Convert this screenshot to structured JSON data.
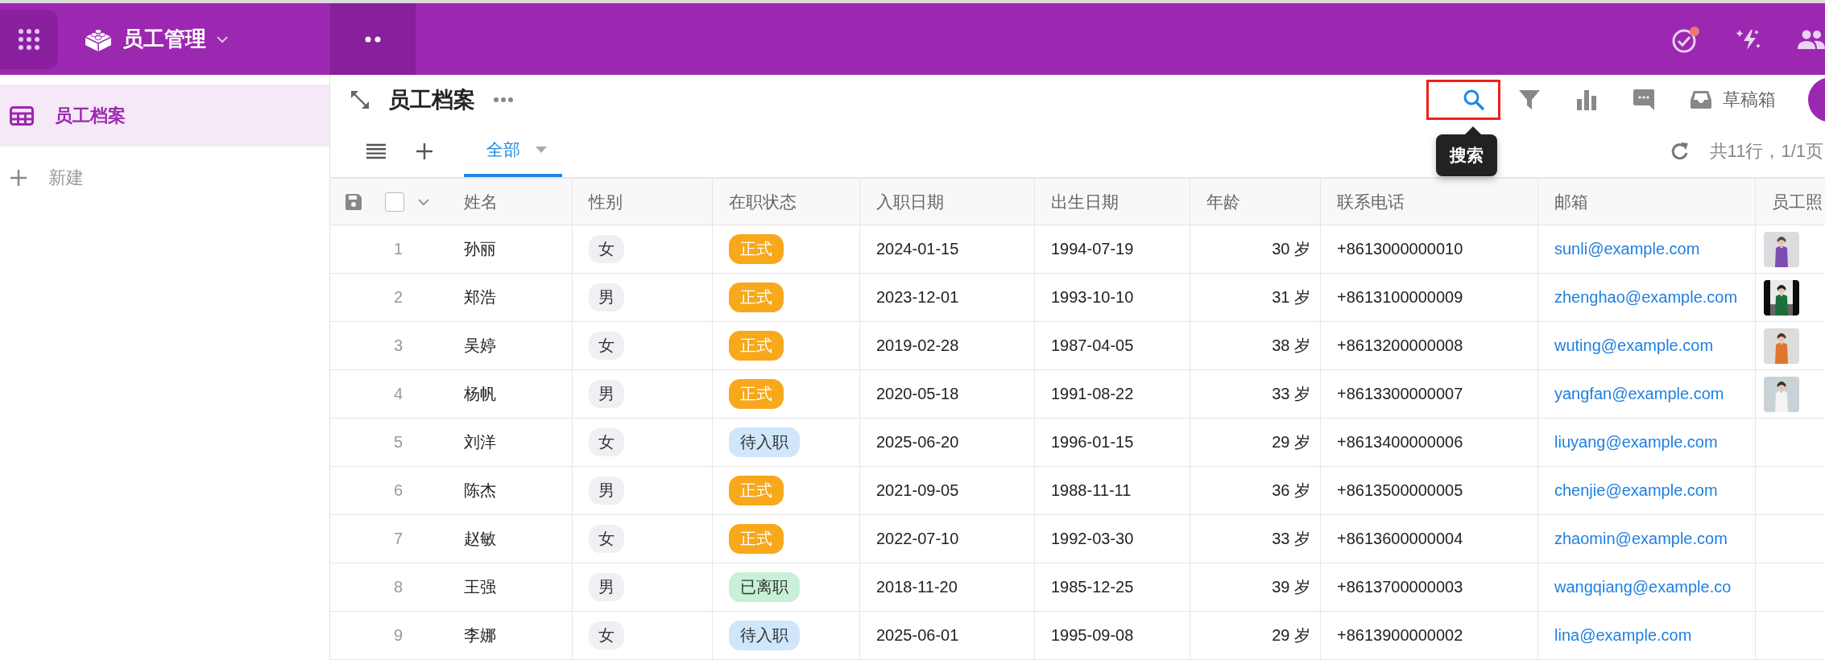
{
  "app": {
    "title": "员工管理"
  },
  "sidebar": {
    "items": [
      {
        "kind": "table",
        "label": "员工档案",
        "selected": true
      },
      {
        "kind": "add",
        "label": "新建",
        "selected": false
      }
    ]
  },
  "view": {
    "title": "员工档案",
    "tools": [
      {
        "kind": "search",
        "highlighted": true,
        "tooltip": "搜索"
      },
      {
        "kind": "filter",
        "highlighted": false
      },
      {
        "kind": "chart",
        "highlighted": false
      },
      {
        "kind": "comment",
        "highlighted": false
      },
      {
        "kind": "drafts",
        "highlighted": false,
        "label": "草稿箱"
      }
    ],
    "tabs": [
      {
        "label": "全部",
        "selected": true
      }
    ],
    "summary": "共11行，1/1页"
  },
  "table": {
    "select_all": {
      "checked": false
    },
    "columns": [
      "姓名",
      "性别",
      "在职状态",
      "入职日期",
      "出生日期",
      "年龄",
      "联系电话",
      "邮箱",
      "员工照"
    ],
    "rows": [
      {
        "index": "1",
        "name": "孙丽",
        "gender": "女",
        "status": {
          "label": "正式",
          "color": "#f7a81b"
        },
        "hire_date": "2024-01-15",
        "birth_date": "1994-07-19",
        "age": "30 岁",
        "phone": "+8613000000010",
        "email": "sunli@example.com"
      },
      {
        "index": "2",
        "name": "郑浩",
        "gender": "男",
        "status": {
          "label": "正式",
          "color": "#f7a81b"
        },
        "hire_date": "2023-12-01",
        "birth_date": "1993-10-10",
        "age": "31 岁",
        "phone": "+8613100000009",
        "email": "zhenghao@example.com"
      },
      {
        "index": "3",
        "name": "吴婷",
        "gender": "女",
        "status": {
          "label": "正式",
          "color": "#f7a81b"
        },
        "hire_date": "2019-02-28",
        "birth_date": "1987-04-05",
        "age": "38 岁",
        "phone": "+8613200000008",
        "email": "wuting@example.com"
      },
      {
        "index": "4",
        "name": "杨帆",
        "gender": "男",
        "status": {
          "label": "正式",
          "color": "#f7a81b"
        },
        "hire_date": "2020-05-18",
        "birth_date": "1991-08-22",
        "age": "33 岁",
        "phone": "+8613300000007",
        "email": "yangfan@example.com"
      },
      {
        "index": "5",
        "name": "刘洋",
        "gender": "女",
        "status": {
          "label": "待入职",
          "color": "#cfe6fb"
        },
        "hire_date": "2025-06-20",
        "birth_date": "1996-01-15",
        "age": "29 岁",
        "phone": "+8613400000006",
        "email": "liuyang@example.com"
      },
      {
        "index": "6",
        "name": "陈杰",
        "gender": "男",
        "status": {
          "label": "正式",
          "color": "#f7a81b"
        },
        "hire_date": "2021-09-05",
        "birth_date": "1988-11-11",
        "age": "36 岁",
        "phone": "+8613500000005",
        "email": "chenjie@example.com"
      },
      {
        "index": "7",
        "name": "赵敏",
        "gender": "女",
        "status": {
          "label": "正式",
          "color": "#f7a81b"
        },
        "hire_date": "2022-07-10",
        "birth_date": "1992-03-30",
        "age": "33 岁",
        "phone": "+8613600000004",
        "email": "zhaomin@example.com"
      },
      {
        "index": "8",
        "name": "王强",
        "gender": "男",
        "status": {
          "label": "已离职",
          "color": "#c8f0d6"
        },
        "hire_date": "2018-11-20",
        "birth_date": "1985-12-25",
        "age": "39 岁",
        "phone": "+8613700000003",
        "email": "wangqiang@example.co"
      },
      {
        "index": "9",
        "name": "李娜",
        "gender": "女",
        "status": {
          "label": "待入职",
          "color": "#cfe6fb"
        },
        "hire_date": "2025-06-01",
        "birth_date": "1995-09-08",
        "age": "29 岁",
        "phone": "+8613900000002",
        "email": "lina@example.com"
      }
    ]
  }
}
